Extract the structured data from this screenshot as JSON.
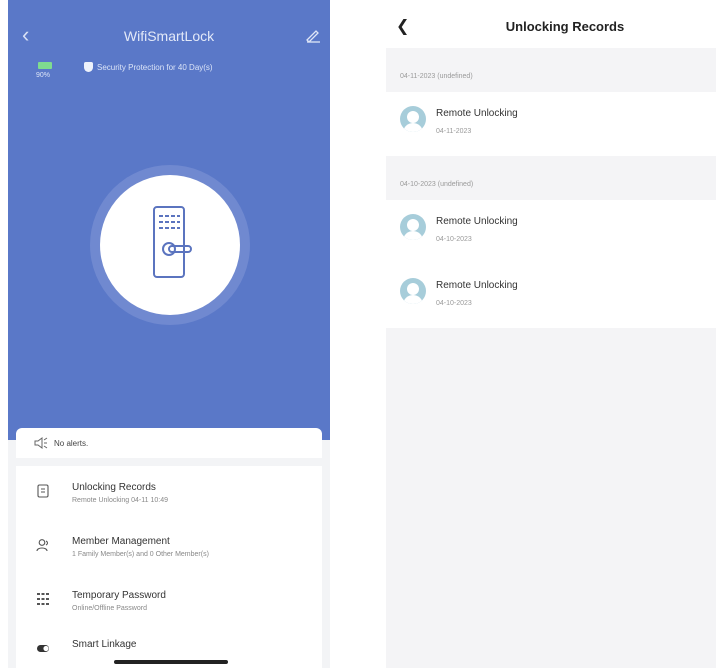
{
  "left": {
    "title": "WifiSmartLock",
    "battery_percent": "90%",
    "security_text": "Security Protection for 40 Day(s)",
    "alerts_text": "No alerts.",
    "menu": [
      {
        "title": "Unlocking Records",
        "subtitle": "Remote Unlocking 04-11 10:49"
      },
      {
        "title": "Member Management",
        "subtitle": "1 Family Member(s) and 0 Other Member(s)"
      },
      {
        "title": "Temporary Password",
        "subtitle": "Online/Offline Password"
      },
      {
        "title": "Smart Linkage",
        "subtitle": ""
      }
    ],
    "colors": {
      "hero": "#5a78c8",
      "ring": "#7089d0"
    }
  },
  "right": {
    "title": "Unlocking Records",
    "groups": [
      {
        "header": "04-11-2023 (undefined)",
        "records": [
          {
            "name": "Remote Unlocking",
            "date": "04-11-2023"
          }
        ]
      },
      {
        "header": "04-10-2023 (undefined)",
        "records": [
          {
            "name": "Remote Unlocking",
            "date": "04-10-2023"
          },
          {
            "name": "Remote Unlocking",
            "date": "04-10-2023"
          }
        ]
      }
    ]
  }
}
